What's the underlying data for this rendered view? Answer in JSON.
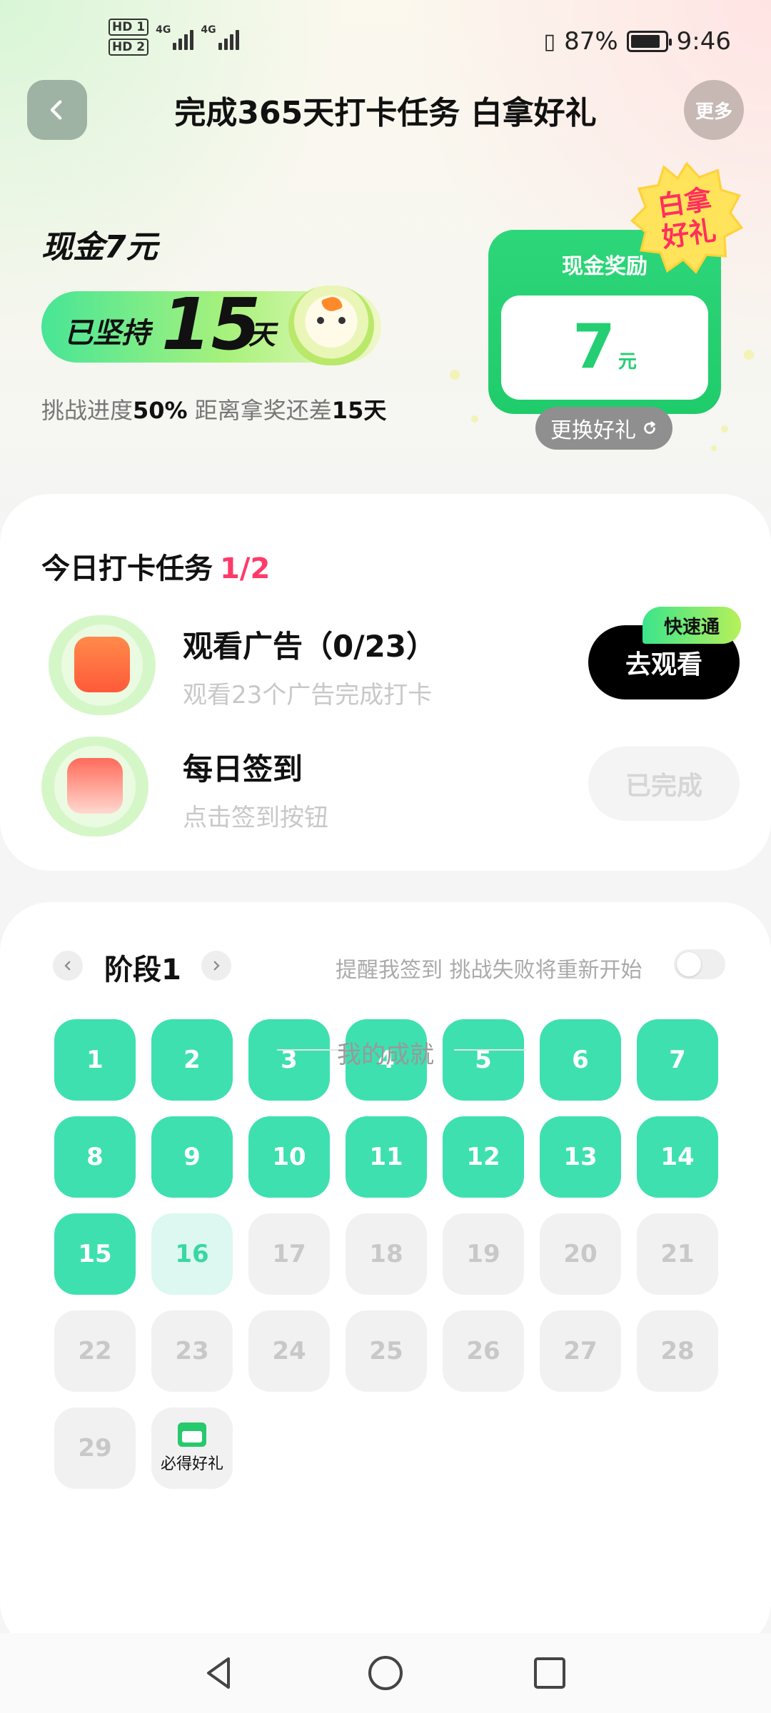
{
  "status_bar": {
    "hd1": "HD 1",
    "hd2": "HD 2",
    "net1": "4G",
    "net2": "4G",
    "battery_pct": "87%",
    "battery_level": 0.87,
    "time": "9:46"
  },
  "header": {
    "title": "完成365天打卡任务 白拿好礼",
    "more_label": "更多"
  },
  "hero": {
    "cash_title": "现金7元",
    "streak_prefix": "已坚持",
    "streak_days": "15",
    "streak_suffix": "天",
    "progress_prefix": "挑战进度",
    "progress_pct": "50%",
    "progress_mid": "距离拿奖还差",
    "progress_remaining": "15天"
  },
  "reward": {
    "title": "现金奖励",
    "amount": "7",
    "unit": "元",
    "badge": "白拿好礼",
    "swap_label": "更换好礼"
  },
  "tasks": {
    "title": "今日打卡任务",
    "count": "1/2",
    "items": [
      {
        "name": "观看广告（0/23）",
        "desc": "观看23个广告完成打卡",
        "button": "去观看",
        "tag": "快速通"
      },
      {
        "name": "每日签到",
        "desc": "点击签到按钮",
        "button": "已完成"
      }
    ]
  },
  "calendar": {
    "stage": "阶段1",
    "remind_text": "提醒我签到 挑战失败将重新开始",
    "days": [
      "1",
      "2",
      "3",
      "4",
      "5",
      "6",
      "7",
      "8",
      "9",
      "10",
      "11",
      "12",
      "13",
      "14",
      "15",
      "16",
      "17",
      "18",
      "19",
      "20",
      "21",
      "22",
      "23",
      "24",
      "25",
      "26",
      "27",
      "28",
      "29"
    ],
    "completed_days": 15,
    "today": "16",
    "gift_label": "必得好礼"
  },
  "achievements_title": "我的成就",
  "colors": {
    "accent_green": "#3ee0b0",
    "reward_green": "#23cf72",
    "count_red": "#ff3a6b"
  }
}
